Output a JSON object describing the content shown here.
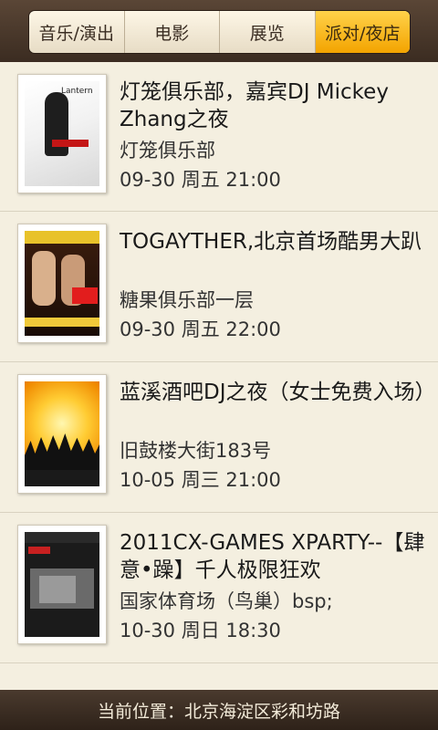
{
  "tabs": [
    {
      "label": "音乐/演出",
      "active": false
    },
    {
      "label": "电影",
      "active": false
    },
    {
      "label": "展览",
      "active": false
    },
    {
      "label": "派对/夜店",
      "active": true
    }
  ],
  "events": [
    {
      "title": "灯笼俱乐部，嘉宾DJ Mickey Zhang之夜",
      "venue": "灯笼俱乐部",
      "time": "09-30 周五 21:00"
    },
    {
      "title": "TOGAYTHER,北京首场酷男大趴",
      "venue": "糖果俱乐部一层",
      "time": "09-30 周五 22:00"
    },
    {
      "title": "蓝溪酒吧DJ之夜（女士免费入场）",
      "venue": "旧鼓楼大街183号",
      "time": "10-05 周三 21:00"
    },
    {
      "title": "2011CX-GAMES XPARTY--【肆意•躁】千人极限狂欢",
      "venue": "国家体育场（鸟巢）bsp;",
      "time": "10-30 周日 18:30"
    }
  ],
  "footer": {
    "location": "当前位置：北京海淀区彩和坊路"
  },
  "colors": {
    "accent": "#f3a400",
    "header": "#3b2c21",
    "background": "#f4efe0"
  }
}
